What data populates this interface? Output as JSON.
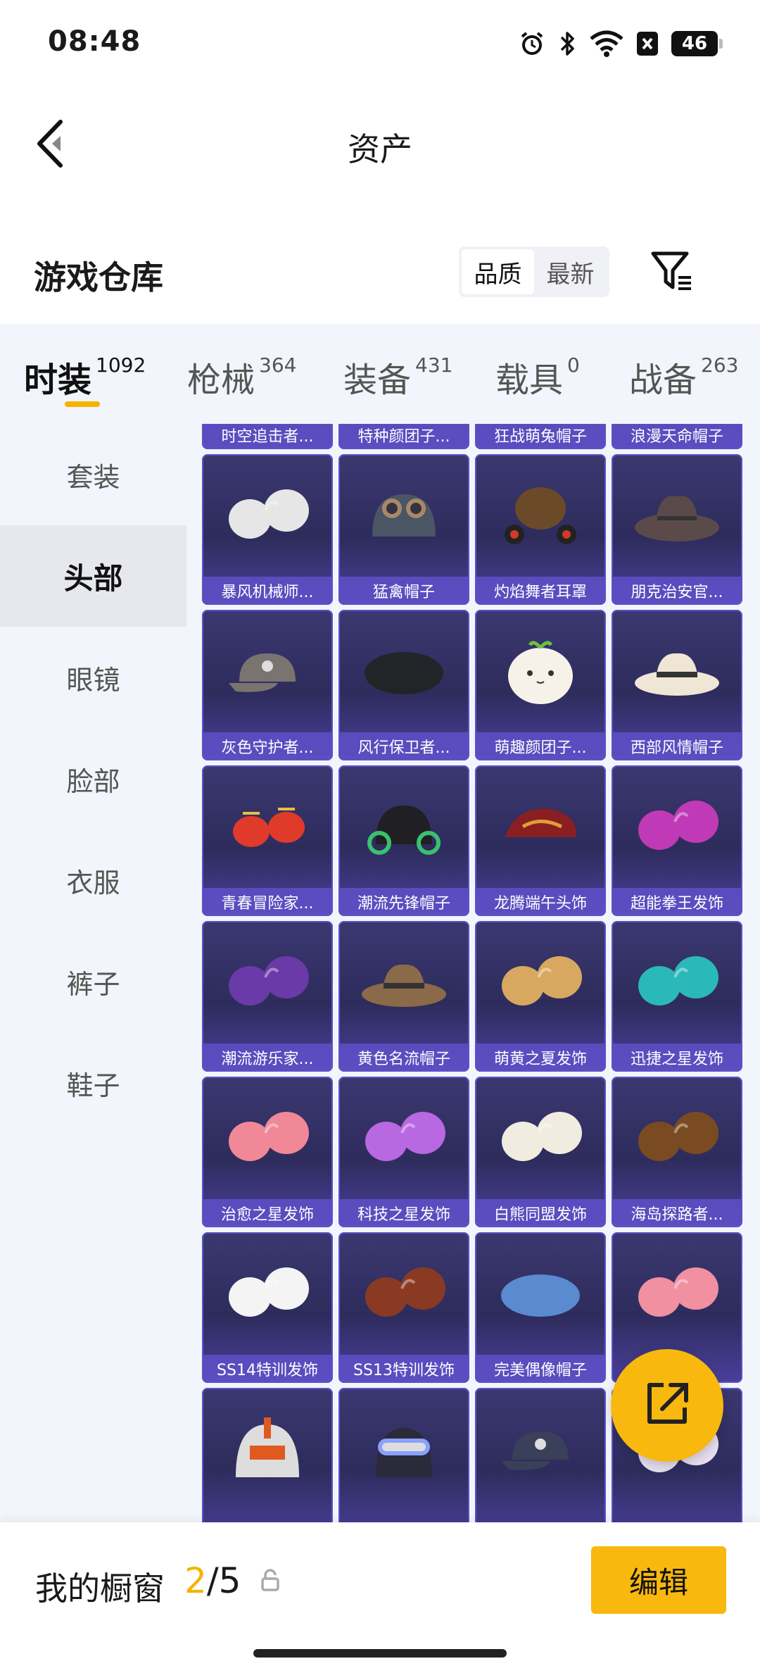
{
  "status_bar": {
    "time": "08:48",
    "battery": "46"
  },
  "header": {
    "title": "资产"
  },
  "warehouse": {
    "title": "游戏仓库",
    "sort_options": [
      "品质",
      "最新"
    ],
    "active_sort": "品质"
  },
  "tabs": [
    {
      "label": "时装",
      "count": "1092",
      "active": true
    },
    {
      "label": "枪械",
      "count": "364",
      "active": false
    },
    {
      "label": "装备",
      "count": "431",
      "active": false
    },
    {
      "label": "载具",
      "count": "0",
      "active": false
    },
    {
      "label": "战备",
      "count": "263",
      "active": false
    }
  ],
  "sidebar": {
    "items": [
      {
        "label": "套装"
      },
      {
        "label": "头部"
      },
      {
        "label": "眼镜"
      },
      {
        "label": "脸部"
      },
      {
        "label": "衣服"
      },
      {
        "label": "裤子"
      },
      {
        "label": "鞋子"
      }
    ],
    "active": "头部"
  },
  "items": [
    {
      "name": "时空追击者...",
      "icon": "hat-icon",
      "color": "#8a7fbf"
    },
    {
      "name": "特种颜团子...",
      "icon": "hat-icon",
      "color": "#8a7fbf"
    },
    {
      "name": "狂战萌兔帽子",
      "icon": "hat-icon",
      "color": "#8a7fbf"
    },
    {
      "name": "浪漫天命帽子",
      "icon": "hat-icon",
      "color": "#8a7fbf"
    },
    {
      "name": "暴风机械师...",
      "icon": "hair-icon",
      "color": "#e6e6e6"
    },
    {
      "name": "猛禽帽子",
      "icon": "pilot-helmet-icon",
      "color": "#4a5566"
    },
    {
      "name": "灼焰舞者耳罩",
      "icon": "earmuff-icon",
      "color": "#6b4a2a"
    },
    {
      "name": "朋克治安官...",
      "icon": "cowboy-hat-icon",
      "color": "#5a4a4a"
    },
    {
      "name": "灰色守护者...",
      "icon": "cap-icon",
      "color": "#7a7470"
    },
    {
      "name": "风行保卫者...",
      "icon": "beret-icon",
      "color": "#222428"
    },
    {
      "name": "萌趣颜团子...",
      "icon": "mochi-icon",
      "color": "#f6f2ea"
    },
    {
      "name": "西部风情帽子",
      "icon": "fedora-icon",
      "color": "#efe6d6"
    },
    {
      "name": "青春冒险家...",
      "icon": "propeller-cap-icon",
      "color": "#e03a2a"
    },
    {
      "name": "潮流先锋帽子",
      "icon": "headphone-beanie-icon",
      "color": "#1f1f24"
    },
    {
      "name": "龙腾端午头饰",
      "icon": "flat-cap-icon",
      "color": "#8a1f22"
    },
    {
      "name": "超能拳王发饰",
      "icon": "hair-icon",
      "color": "#c03ab8"
    },
    {
      "name": "潮流游乐家...",
      "icon": "hair-icon",
      "color": "#6a3aa8"
    },
    {
      "name": "黄色名流帽子",
      "icon": "fedora-icon",
      "color": "#8a6a48"
    },
    {
      "name": "萌黄之夏发饰",
      "icon": "hair-icon",
      "color": "#d8a860"
    },
    {
      "name": "迅捷之星发饰",
      "icon": "hair-icon",
      "color": "#2ab8b8"
    },
    {
      "name": "治愈之星发饰",
      "icon": "hair-icon",
      "color": "#f08898"
    },
    {
      "name": "科技之星发饰",
      "icon": "hair-icon",
      "color": "#b868e0"
    },
    {
      "name": "白熊同盟发饰",
      "icon": "hair-icon",
      "color": "#f0ece0"
    },
    {
      "name": "海岛探路者...",
      "icon": "hair-icon",
      "color": "#7a4a22"
    },
    {
      "name": "SS14特训发饰",
      "icon": "hair-icon",
      "color": "#f4f4f4"
    },
    {
      "name": "SS13特训发饰",
      "icon": "hair-icon",
      "color": "#8a3a22"
    },
    {
      "name": "完美偶像帽子",
      "icon": "beret-icon",
      "color": "#5a8ad0"
    },
    {
      "name": "",
      "icon": "hair-icon",
      "color": "#f090a0"
    },
    {
      "name": "",
      "icon": "helmet-icon",
      "color": "#e05a20"
    },
    {
      "name": "",
      "icon": "goggles-icon",
      "color": "#2a2a3a"
    },
    {
      "name": "",
      "icon": "cap-icon",
      "color": "#3a3f5a"
    },
    {
      "name": "",
      "icon": "hair-icon",
      "color": "#e8e0f0"
    }
  ],
  "showcase": {
    "label": "我的橱窗",
    "current": "2",
    "separator": "/",
    "total": "5"
  },
  "edit_label": "编辑",
  "colors": {
    "accent": "#f8b80d",
    "card_bg": "#2e2c5c",
    "caption_bg": "#5f50c8"
  }
}
